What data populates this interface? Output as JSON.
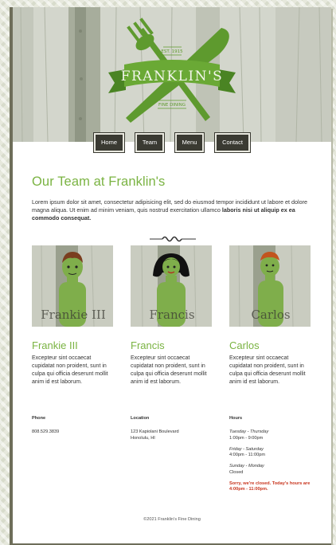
{
  "brand": {
    "name": "FRANKLIN'S",
    "est": "EST. 1915",
    "tagline": "FINE DINING",
    "accent": "#7ab342"
  },
  "nav": {
    "items": [
      "Home",
      "Team",
      "Menu",
      "Contact"
    ]
  },
  "main": {
    "title": "Our Team at Franklin's",
    "intro": "Lorem ipsum dolor sit amet, consectetur adipisicing elit, sed do eiusmod tempor incididunt ut labore et dolore magna aliqua. Ut enim ad minim veniam, quis nostrud exercitation ullamco ",
    "intro_bold": "laboris nisi ut aliquip ex ea commodo consequat."
  },
  "team": [
    {
      "photo_label": "Frankie III",
      "name": "Frankie III",
      "bio": "Excepteur sint occaecat cupidatat non proident, sunt in culpa qui officia deserunt mollit anim id est laborum."
    },
    {
      "photo_label": "Francis",
      "name": "Francis",
      "bio": "Excepteur sint occaecat cupidatat non proident, sunt in culpa qui officia deserunt mollit anim id est laborum."
    },
    {
      "photo_label": "Carlos",
      "name": "Carlos",
      "bio": "Excepteur sint occaecat cupidatat non proident, sunt in culpa qui officia deserunt mollit anim id est laborum."
    }
  ],
  "contact": {
    "phone_heading": "Phone",
    "phone": "808.529.3839",
    "location_heading": "Location",
    "address_line1": "123 Kapiolani Boulevard",
    "address_line2": "Honolulu, HI",
    "hours_heading": "Hours",
    "hours": [
      {
        "days": "Tuesday - Thursday",
        "time": "1:00pm - 9:00pm"
      },
      {
        "days": "Friday - Saturday",
        "time": "4:00pm - 11:00pm"
      },
      {
        "days": "Sunday - Monday",
        "time": "Closed"
      }
    ],
    "closed_notice": "Sorry, we're closed. Today's hours are 4:00pm - 11:00pm."
  },
  "footer": {
    "copyright": "©2021 Franklin's Fine Dining"
  }
}
